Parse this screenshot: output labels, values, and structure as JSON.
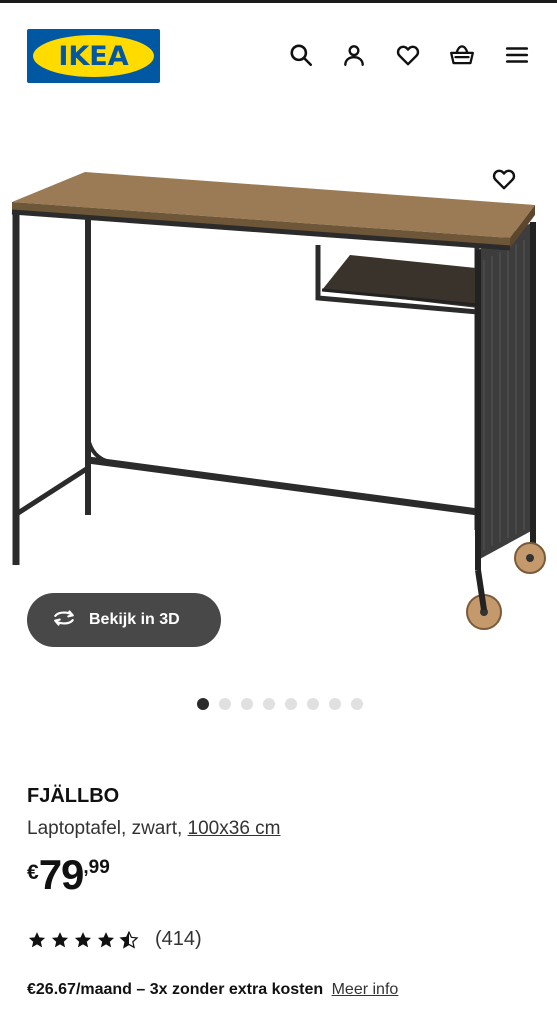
{
  "header": {
    "logo_text": "IKEA",
    "brand_colors": {
      "blue": "#0058a3",
      "yellow": "#ffdb00"
    },
    "icons": [
      "search-icon",
      "user-icon",
      "heart-icon",
      "basket-icon",
      "menu-icon"
    ]
  },
  "gallery": {
    "view_3d_label": "Bekijk in 3D",
    "image_count": 8,
    "active_index": 0
  },
  "product": {
    "name": "FJÄLLBO",
    "description": "Laptoptafel, zwart, ",
    "size_link": "100x36 cm",
    "price": {
      "currency": "€",
      "integer": "79",
      "decimals": ",99"
    },
    "rating": {
      "value": 4.5,
      "max": 5,
      "count_text": "(414)"
    },
    "financing": {
      "text": "€26.67/maand – 3x zonder extra kosten",
      "link_label": "Meer info"
    }
  }
}
